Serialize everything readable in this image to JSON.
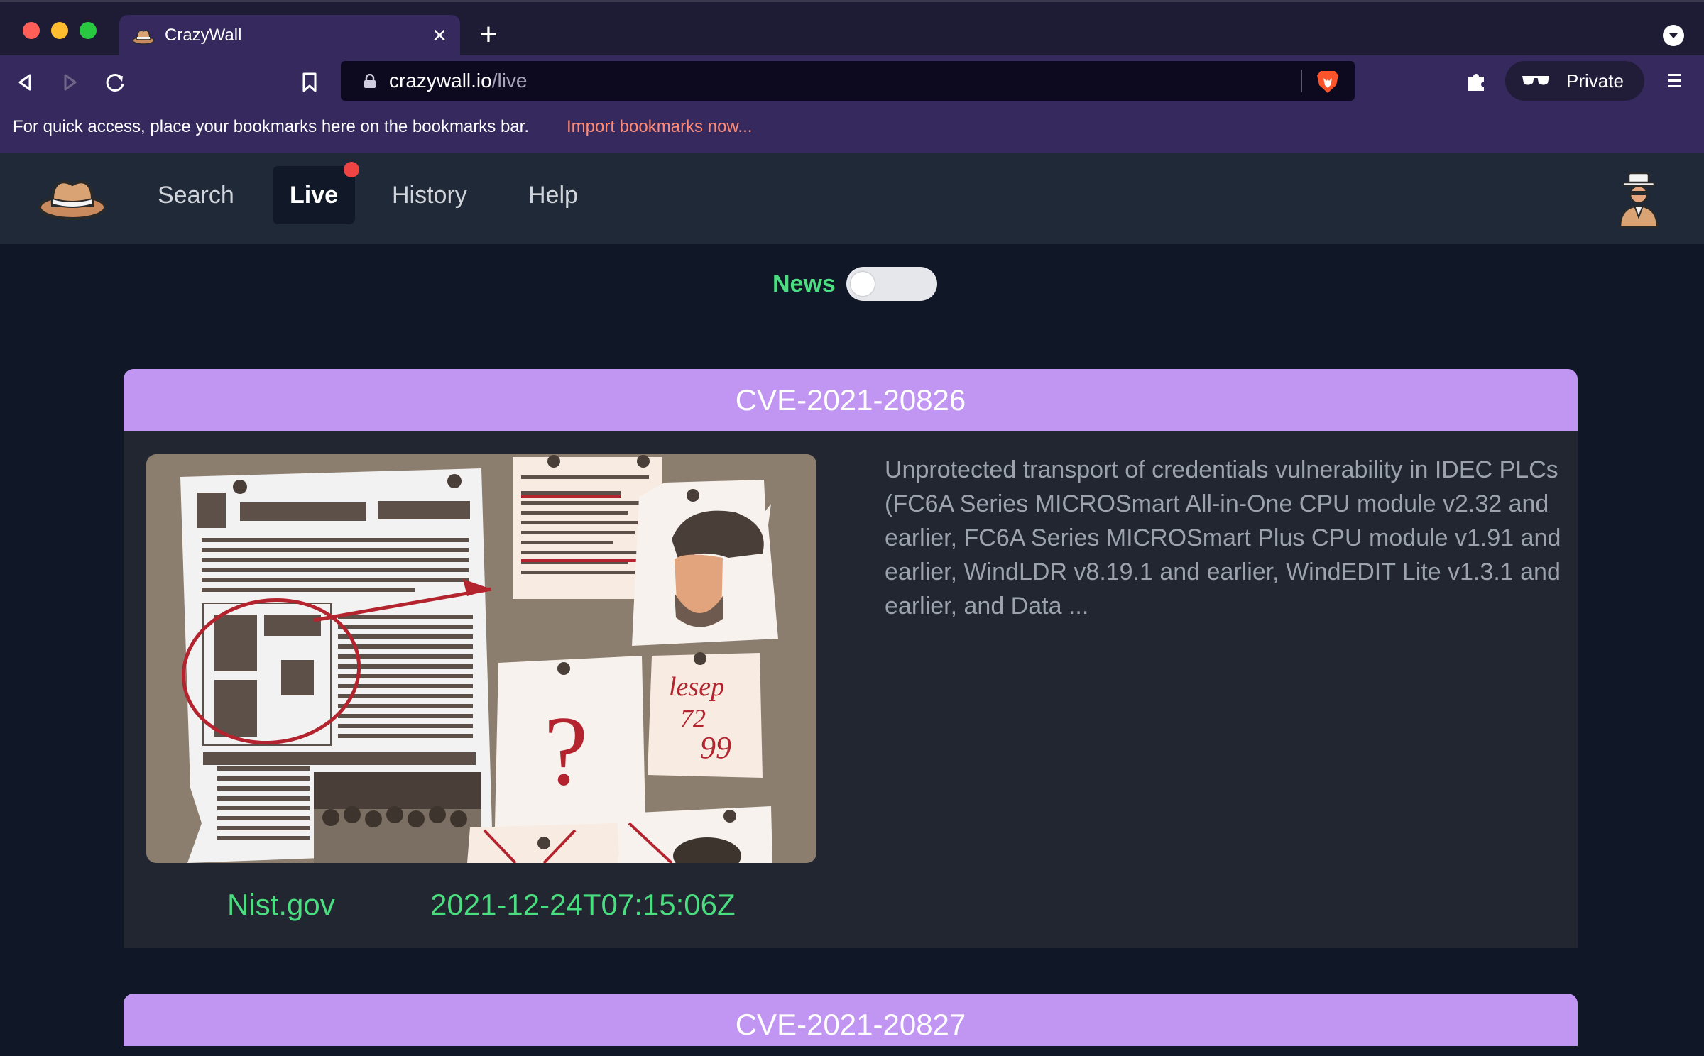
{
  "browser": {
    "tab": {
      "title": "CrazyWall",
      "favicon": "hat-icon"
    },
    "url": {
      "host": "crazywall.io",
      "path": "/live"
    },
    "private_label": "Private",
    "bookmarks_bar": {
      "message": "For quick access, place your bookmarks here on the bookmarks bar.",
      "link": "Import bookmarks now..."
    }
  },
  "nav": {
    "items": [
      {
        "label": "Search"
      },
      {
        "label": "Live",
        "active": true,
        "badge": "red-dot"
      },
      {
        "label": "History"
      },
      {
        "label": "Help"
      }
    ]
  },
  "news_toggle": {
    "label": "News",
    "on": false
  },
  "cards": [
    {
      "title": "CVE-2021-20826",
      "description": "Unprotected transport of credentials vulnerability in IDEC PLCs (FC6A Series MICROSmart All-in-One CPU module v2.32 and earlier, FC6A Series MICROSmart Plus CPU module v1.91 and earlier, WindLDR v8.19.1 and earlier, WindEDIT Lite v1.3.1 and earlier, and Data ...",
      "source": "Nist.gov",
      "date": "2021-12-24T07:15:06Z",
      "image": "investigation-board-illustration",
      "image_text": {
        "note_text": "lesep",
        "numbers": [
          "72",
          "99"
        ]
      }
    },
    {
      "title": "CVE-2021-20827"
    }
  ],
  "colors": {
    "card_header": "#c196f2",
    "accent_green": "#4ade80",
    "live_badge": "#ef4444",
    "browser_purple": "#35295d"
  }
}
